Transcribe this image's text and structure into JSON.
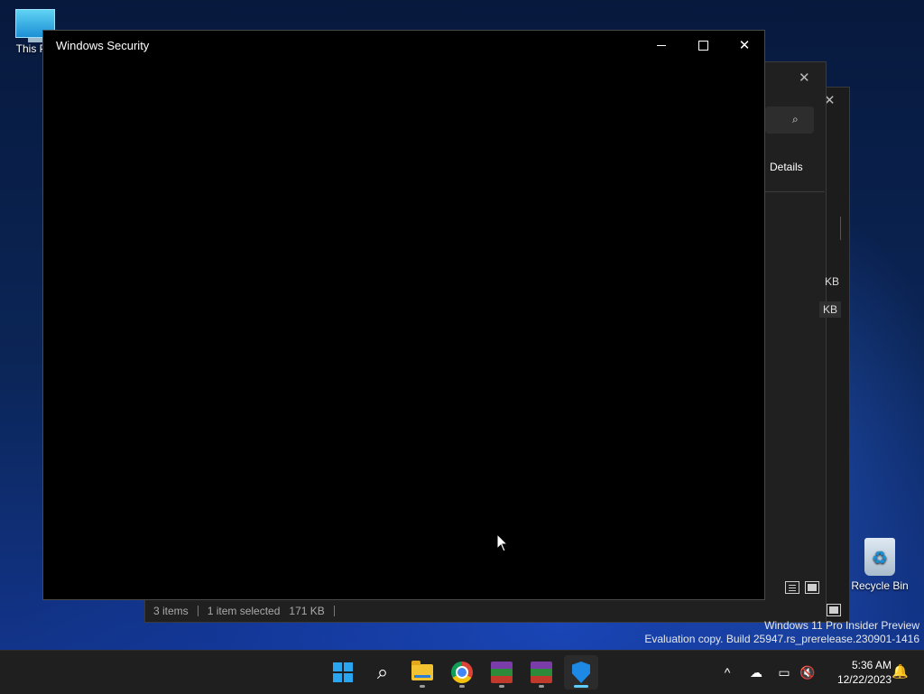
{
  "desktop": {
    "icons": [
      {
        "label": "This PC"
      },
      {
        "label": "Recycle Bin"
      }
    ]
  },
  "background_window": {
    "details_label": "Details",
    "file_sizes": [
      "KB",
      "KB"
    ],
    "status": {
      "items": "3 items",
      "selected": "1 item selected",
      "size": "171 KB"
    }
  },
  "security_window": {
    "title": "Windows Security",
    "controls": {
      "minimize": "minimize-icon",
      "maximize": "maximize-icon",
      "close": "close-icon"
    }
  },
  "watermark": {
    "line1": "Windows 11 Pro Insider Preview",
    "line2": "Evaluation copy. Build 25947.rs_prerelease.230901-1416"
  },
  "taskbar": {
    "apps": [
      {
        "name": "Start",
        "icon": "windows-logo-icon"
      },
      {
        "name": "Search",
        "icon": "search-icon"
      },
      {
        "name": "File Explorer",
        "icon": "folder-icon"
      },
      {
        "name": "Google Chrome",
        "icon": "chrome-icon"
      },
      {
        "name": "WinRAR",
        "icon": "winrar-icon"
      },
      {
        "name": "WinRAR",
        "icon": "winrar-icon"
      },
      {
        "name": "Windows Security",
        "icon": "shield-icon",
        "active": true
      }
    ],
    "clock": {
      "time": "5:36 AM",
      "date": "12/22/2023"
    },
    "accent": "#60cdff"
  }
}
